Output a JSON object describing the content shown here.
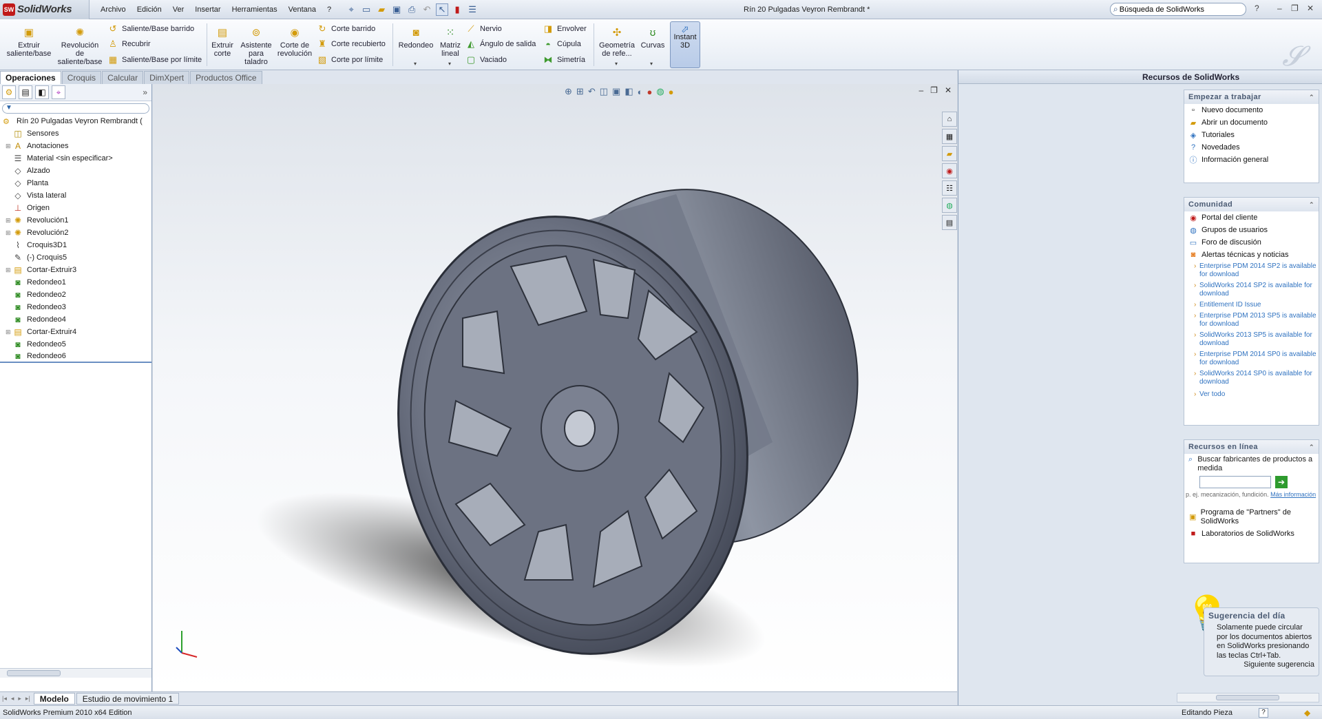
{
  "app": {
    "name": "SolidWorks",
    "logo_badge": "SW"
  },
  "menu": [
    "Archivo",
    "Edición",
    "Ver",
    "Insertar",
    "Herramientas",
    "Ventana",
    "?"
  ],
  "document_title": "Rín 20 Pulgadas Veyron Rembrandt *",
  "search": {
    "value": "Búsqueda de SolidWorks"
  },
  "ribbon": {
    "extrude_boss": "Extruir saliente/base",
    "revolve_boss": "Revolución de saliente/base",
    "swept_boss": "Saliente/Base barrido",
    "loft": "Recubrir",
    "boundary_boss": "Saliente/Base por límite",
    "extruded_cut": "Extruir corte",
    "hole_wizard": "Asistente para taladro",
    "revolved_cut": "Corte de revolución",
    "swept_cut": "Corte barrido",
    "lofted_cut": "Corte recubierto",
    "boundary_cut": "Corte por límite",
    "fillet": "Redondeo",
    "linear_pattern": "Matriz lineal",
    "rib": "Nervio",
    "draft": "Ángulo de salida",
    "shell": "Vaciado",
    "wrap": "Envolver",
    "dome": "Cúpula",
    "mirror": "Simetría",
    "ref_geometry": "Geometría de refe...",
    "curves": "Curvas",
    "instant3d": "Instant 3D"
  },
  "command_tabs": [
    "Operaciones",
    "Croquis",
    "Calcular",
    "DimXpert",
    "Productos Office"
  ],
  "feature_tree": {
    "root": "Rín 20 Pulgadas Veyron Rembrandt  (",
    "items": [
      {
        "label": "Sensores",
        "icon": "sensor-icon",
        "expandable": false
      },
      {
        "label": "Anotaciones",
        "icon": "annotation-icon",
        "expandable": true
      },
      {
        "label": "Material <sin especificar>",
        "icon": "material-icon",
        "expandable": false
      },
      {
        "label": "Alzado",
        "icon": "plane-icon",
        "expandable": false
      },
      {
        "label": "Planta",
        "icon": "plane-icon",
        "expandable": false
      },
      {
        "label": "Vista lateral",
        "icon": "plane-icon",
        "expandable": false
      },
      {
        "label": "Origen",
        "icon": "origin-icon",
        "expandable": false
      },
      {
        "label": "Revolución1",
        "icon": "revolve-icon",
        "expandable": true
      },
      {
        "label": "Revolución2",
        "icon": "revolve-icon",
        "expandable": true
      },
      {
        "label": "Croquis3D1",
        "icon": "sketch3d-icon",
        "expandable": false
      },
      {
        "label": "(-) Croquis5",
        "icon": "sketch-icon",
        "expandable": false
      },
      {
        "label": "Cortar-Extruir3",
        "icon": "cut-extrude-icon",
        "expandable": true
      },
      {
        "label": "Redondeo1",
        "icon": "fillet-icon",
        "expandable": false
      },
      {
        "label": "Redondeo2",
        "icon": "fillet-icon",
        "expandable": false
      },
      {
        "label": "Redondeo3",
        "icon": "fillet-icon",
        "expandable": false
      },
      {
        "label": "Redondeo4",
        "icon": "fillet-icon",
        "expandable": false
      },
      {
        "label": "Cortar-Extruir4",
        "icon": "cut-extrude-icon",
        "expandable": true
      },
      {
        "label": "Redondeo5",
        "icon": "fillet-icon",
        "expandable": false
      },
      {
        "label": "Redondeo6",
        "icon": "fillet-icon",
        "expandable": false
      }
    ]
  },
  "task_pane": {
    "title": "Recursos de SolidWorks",
    "getting_started": {
      "header": "Empezar a trabajar",
      "links": [
        "Nuevo documento",
        "Abrir un documento",
        "Tutoriales",
        "Novedades",
        "Información general"
      ]
    },
    "community": {
      "header": "Comunidad",
      "links": [
        "Portal del cliente",
        "Grupos de usuarios",
        "Foro de discusión",
        "Alertas técnicas y noticias"
      ],
      "news": [
        "Enterprise PDM 2014 SP2 is available for download",
        "SolidWorks 2014 SP2 is available for download",
        "Entitlement ID Issue",
        "Enterprise PDM 2013 SP5 is available for download",
        "SolidWorks 2013 SP5 is available for download",
        "Enterprise PDM 2014 SP0 is available for download",
        "SolidWorks 2014 SP0 is available for download",
        "Ver todo"
      ]
    },
    "online": {
      "header": "Recursos en línea",
      "search_label": "Buscar fabricantes de productos a medida",
      "search_value": "",
      "hint": "p. ej. mecanización, fundición.",
      "hint_link": "Más información",
      "links": [
        "Programa de \"Partners\" de SolidWorks",
        "Laboratorios de SolidWorks"
      ]
    },
    "tip": {
      "header": "Sugerencia del día",
      "text": "Solamente puede circular por los documentos abiertos en SolidWorks presionando las teclas Ctrl+Tab.",
      "next": "Siguiente sugerencia"
    }
  },
  "bottom_tabs": [
    "Modelo",
    "Estudio de movimiento 1"
  ],
  "status": {
    "left": "SolidWorks Premium 2010 x64 Edition",
    "right": "Editando Pieza",
    "help": "?"
  },
  "colors": {
    "accent": "#2f72c0",
    "logo_red": "#c01a1a",
    "wheel": "#5e6473"
  }
}
